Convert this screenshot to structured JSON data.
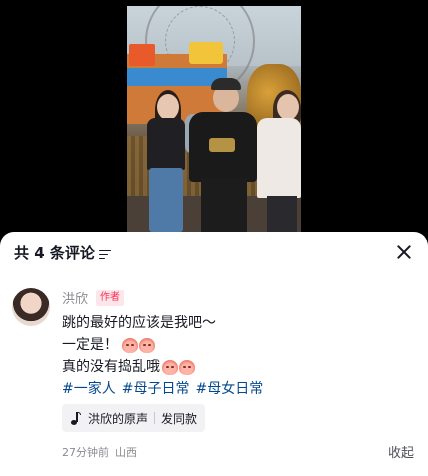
{
  "sheet": {
    "title": "共 4 条评论",
    "sort_icon": "sort-lines-icon",
    "close_icon": "close-icon"
  },
  "comment": {
    "author": "洪欣",
    "badge": "作者",
    "lines": [
      "跳的最好的应该是我吧～",
      "一定是！",
      "真的没有捣乱哦"
    ],
    "emoji": "peach-face-emoji",
    "hashtags": [
      "#一家人",
      "#母子日常",
      "#母女日常"
    ],
    "sound": {
      "icon": "music-note-icon",
      "label": "洪欣的原声",
      "action": "发同款"
    },
    "time": "27分钟前",
    "location": "山西",
    "collapse": "收起"
  },
  "colors": {
    "hashtag": "#04498d",
    "badge": "#fe2c55",
    "text": "#161823",
    "muted": "#8a8b91"
  }
}
